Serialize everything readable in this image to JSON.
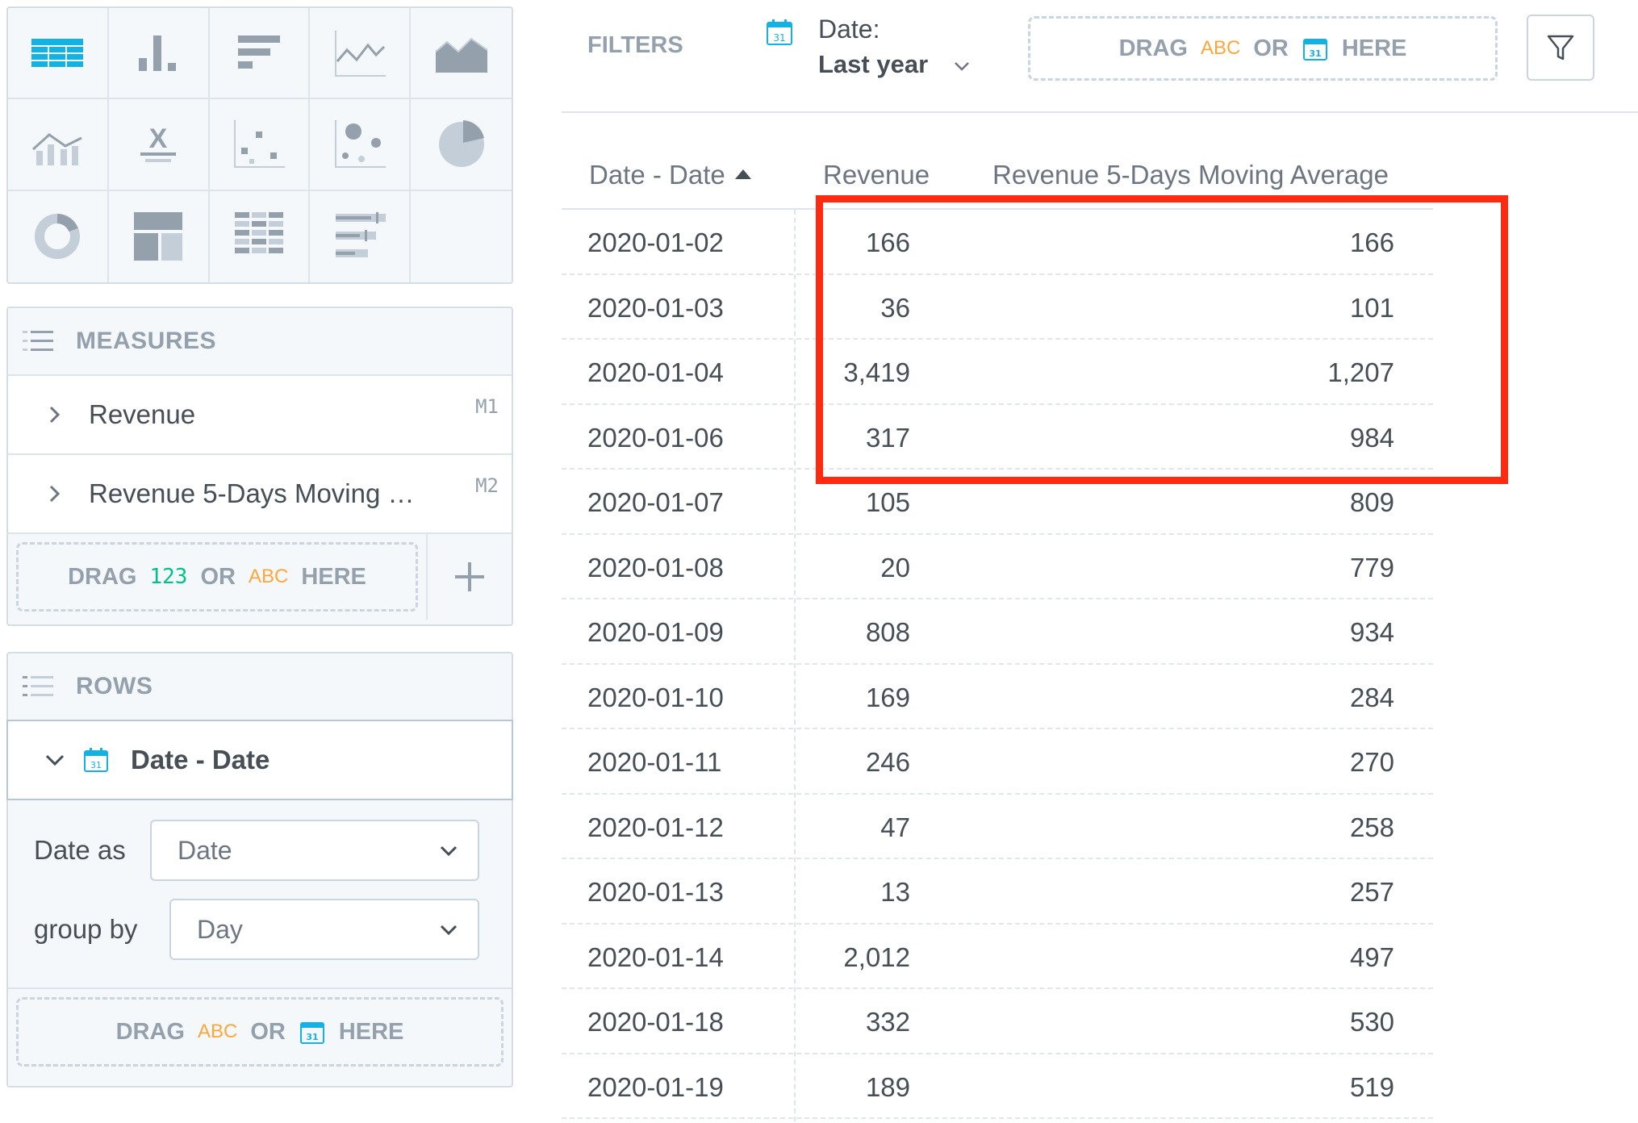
{
  "viz_types": [
    "table-icon",
    "column-chart-icon",
    "bar-chart-icon",
    "line-chart-icon",
    "area-chart-icon",
    "combo-chart-icon",
    "headline-icon",
    "scatter-plot-icon",
    "bubble-chart-icon",
    "pie-chart-icon",
    "donut-chart-icon",
    "treemap-icon",
    "heatmap-icon",
    "bullet-chart-icon"
  ],
  "measures": {
    "title": "MEASURES",
    "items": [
      {
        "label": "Revenue",
        "id": "M1"
      },
      {
        "label": "Revenue 5-Days Moving …",
        "id": "M2"
      }
    ],
    "drop": {
      "drag": "DRAG",
      "num": "123",
      "or": "OR",
      "abc": "ABC",
      "here": "HERE"
    }
  },
  "rows": {
    "title": "ROWS",
    "item_label": "Date - Date",
    "date_as_label": "Date as",
    "date_as_value": "Date",
    "group_by_label": "group by",
    "group_by_value": "Day",
    "drop": {
      "drag": "DRAG",
      "abc": "ABC",
      "or": "OR",
      "here": "HERE"
    }
  },
  "filters": {
    "title": "FILTERS",
    "date_name": "Date:",
    "date_value": "Last year",
    "drop": {
      "drag": "DRAG",
      "abc": "ABC",
      "or": "OR",
      "here": "HERE"
    }
  },
  "table": {
    "headers": {
      "date": "Date - Date",
      "revenue": "Revenue",
      "avg": "Revenue 5-Days Moving Average"
    },
    "rows": [
      {
        "date": "2020-01-02",
        "revenue": "166",
        "avg": "166"
      },
      {
        "date": "2020-01-03",
        "revenue": "36",
        "avg": "101"
      },
      {
        "date": "2020-01-04",
        "revenue": "3,419",
        "avg": "1,207"
      },
      {
        "date": "2020-01-06",
        "revenue": "317",
        "avg": "984"
      },
      {
        "date": "2020-01-07",
        "revenue": "105",
        "avg": "809"
      },
      {
        "date": "2020-01-08",
        "revenue": "20",
        "avg": "779"
      },
      {
        "date": "2020-01-09",
        "revenue": "808",
        "avg": "934"
      },
      {
        "date": "2020-01-10",
        "revenue": "169",
        "avg": "284"
      },
      {
        "date": "2020-01-11",
        "revenue": "246",
        "avg": "270"
      },
      {
        "date": "2020-01-12",
        "revenue": "47",
        "avg": "258"
      },
      {
        "date": "2020-01-13",
        "revenue": "13",
        "avg": "257"
      },
      {
        "date": "2020-01-14",
        "revenue": "2,012",
        "avg": "497"
      },
      {
        "date": "2020-01-18",
        "revenue": "332",
        "avg": "530"
      },
      {
        "date": "2020-01-19",
        "revenue": "189",
        "avg": "519"
      }
    ]
  },
  "colors": {
    "accent": "#14b2e2",
    "highlight": "#ff2a10",
    "measure_green": "#00c18d",
    "attribute_orange": "#fda63b"
  }
}
